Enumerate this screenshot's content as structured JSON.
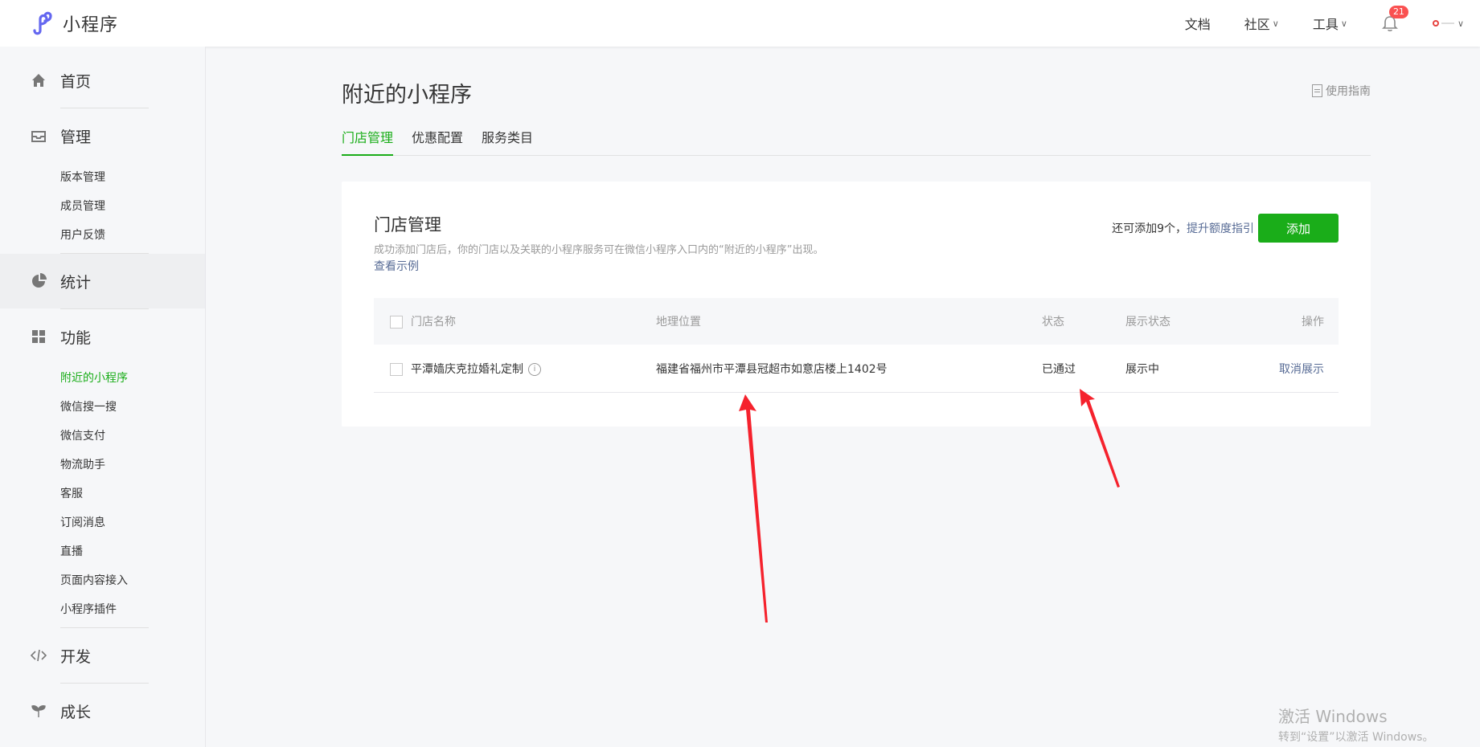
{
  "topbar": {
    "app_name": "小程序",
    "nav": [
      {
        "label": "文档",
        "has_dropdown": false
      },
      {
        "label": "社区",
        "has_dropdown": true
      },
      {
        "label": "工具",
        "has_dropdown": true
      }
    ],
    "notification_count": "21",
    "icons": [
      "logo-icon",
      "bell-icon",
      "chevron-down-icon"
    ]
  },
  "sidebar": {
    "home": "首页",
    "manage": "管理",
    "manage_items": [
      "版本管理",
      "成员管理",
      "用户反馈"
    ],
    "stats": "统计",
    "features": "功能",
    "feature_items": [
      "附近的小程序",
      "微信搜一搜",
      "微信支付",
      "物流助手",
      "客服",
      "订阅消息",
      "直播",
      "页面内容接入",
      "小程序插件"
    ],
    "develop": "开发",
    "grow": "成长",
    "active_item": "附近的小程序"
  },
  "page": {
    "title": "附近的小程序",
    "guide_label": "使用指南",
    "tabs": [
      "门店管理",
      "优惠配置",
      "服务类目"
    ],
    "active_tab": "门店管理"
  },
  "card": {
    "title": "门店管理",
    "description": "成功添加门店后，你的门店以及关联的小程序服务可在微信小程序入口内的“附近的小程序”出现。",
    "example_link": "查看示例",
    "quota_text": "还可添加9个，",
    "quota_link": "提升额度指引",
    "add_button": "添加"
  },
  "table": {
    "headers": {
      "name": "门店名称",
      "location": "地理位置",
      "status": "状态",
      "display": "展示状态",
      "action": "操作"
    },
    "rows": [
      {
        "name": "平潭嫱庆克拉婚礼定制",
        "location": "福建省福州市平潭县冠超市如意店楼上1402号",
        "status": "已通过",
        "display": "展示中",
        "action": "取消展示"
      }
    ]
  },
  "annotations": {
    "arrow_color": "#f5222d"
  },
  "watermark": {
    "title": "激活 Windows",
    "subtitle": "转到“设置”以激活 Windows。"
  },
  "colors": {
    "accent": "#1aad19",
    "link": "#576b95",
    "badge": "#fa5151"
  }
}
